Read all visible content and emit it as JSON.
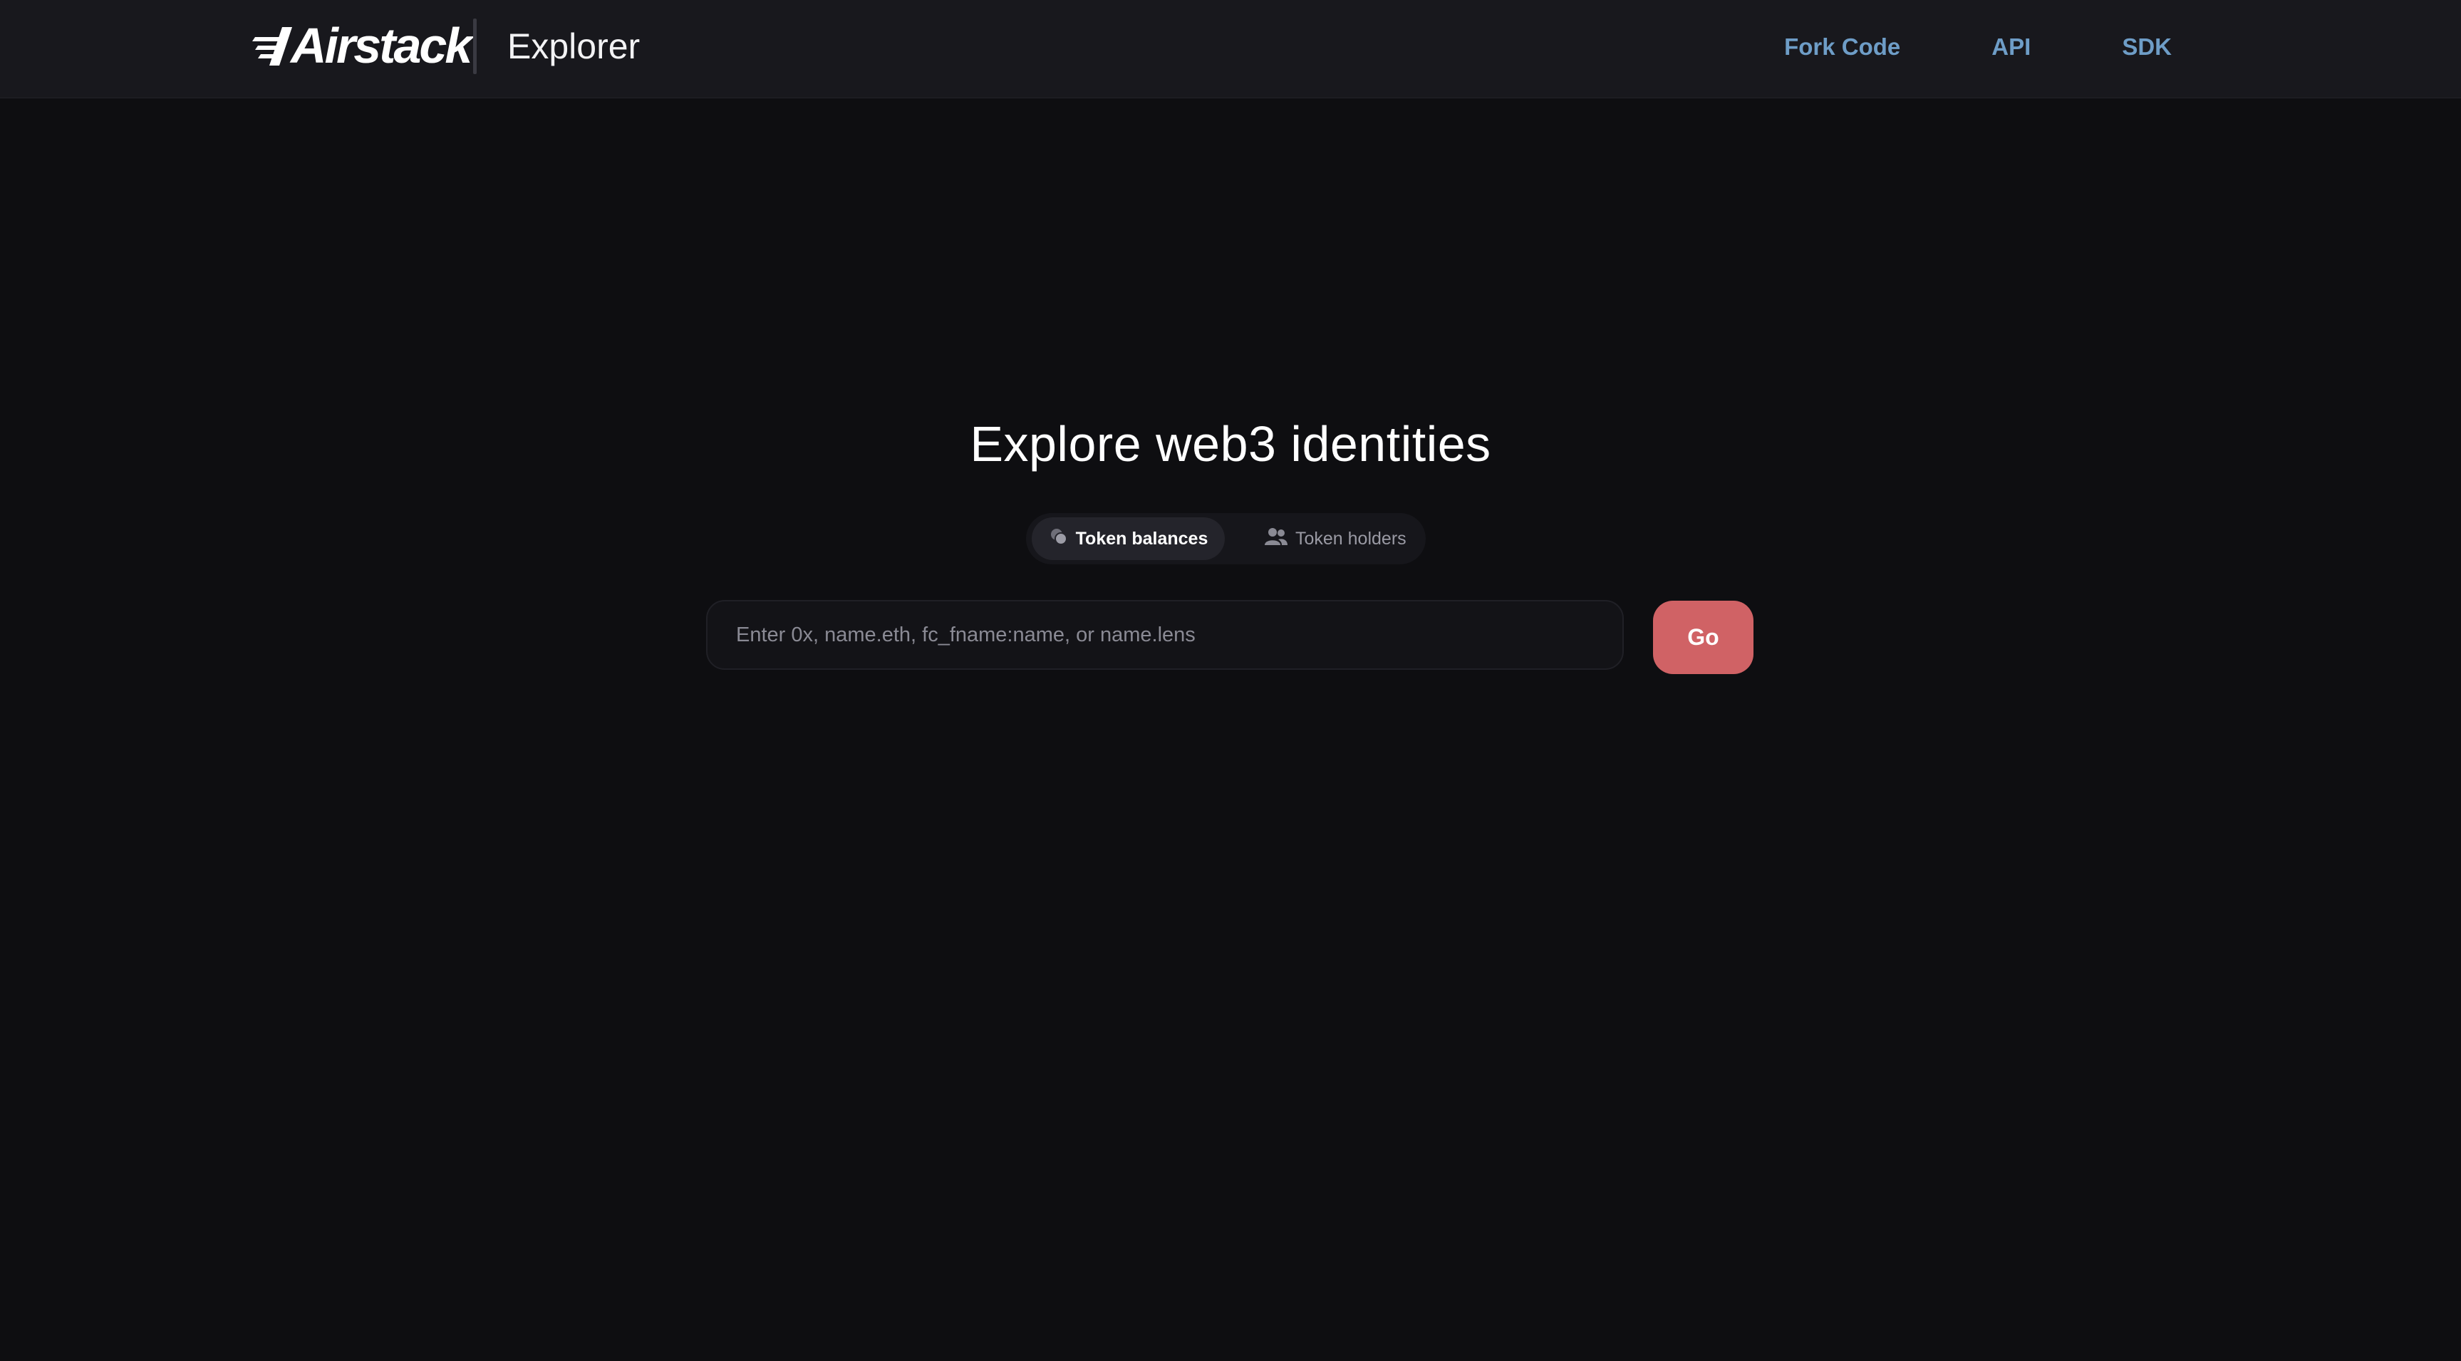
{
  "header": {
    "logo_text": "Airstack",
    "app_label": "Explorer",
    "nav": [
      {
        "label": "Fork Code"
      },
      {
        "label": "API"
      },
      {
        "label": "SDK"
      }
    ],
    "nav_color": "#6e9dc7"
  },
  "main": {
    "title": "Explore web3 identities",
    "tabs": [
      {
        "label": "Token balances",
        "icon": "coins-icon",
        "active": true
      },
      {
        "label": "Token holders",
        "icon": "users-icon",
        "active": false
      }
    ],
    "search": {
      "value": "",
      "placeholder": "Enter 0x, name.eth, fc_fname:name, or name.lens"
    },
    "go_label": "Go",
    "go_color": "#d06265"
  }
}
